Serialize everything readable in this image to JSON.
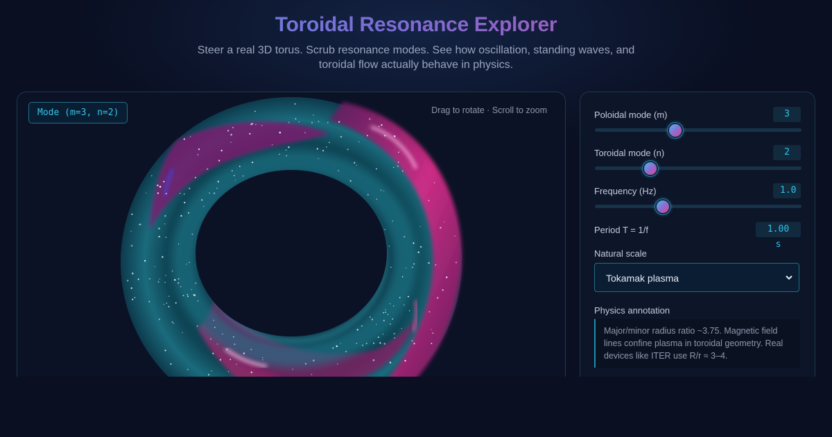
{
  "header": {
    "title": "Toroidal Resonance Explorer",
    "subtitle": "Steer a real 3D torus. Scrub resonance modes. See how oscillation, standing waves, and toroidal flow actually behave in physics."
  },
  "viewer": {
    "mode_badge": "Mode (m=3, n=2)",
    "hint": "Drag to rotate · Scroll to zoom"
  },
  "controls": {
    "poloidal": {
      "label": "Poloidal mode (m)",
      "value": "3",
      "fraction": 0.39
    },
    "toroidal": {
      "label": "Toroidal mode (n)",
      "value": "2",
      "fraction": 0.27
    },
    "frequency": {
      "label": "Frequency (Hz)",
      "value": "1.0",
      "fraction": 0.33
    },
    "period": {
      "label": "Period T = 1/f",
      "value": "1.00 s"
    },
    "scale": {
      "label": "Natural scale",
      "selected": "Tokamak plasma"
    },
    "annotation": {
      "label": "Physics annotation",
      "text": "Major/minor radius ratio ~3.75. Magnetic field lines confine plasma in toroidal geometry. Real devices like ITER use R/r ≈ 3–4."
    }
  },
  "colors": {
    "accent_cyan": "#2fc4ea",
    "accent_magenta": "#c14aa0",
    "panel_border": "#1d3a4e"
  },
  "icons": {
    "select_chevron": "chevron-down-icon"
  }
}
